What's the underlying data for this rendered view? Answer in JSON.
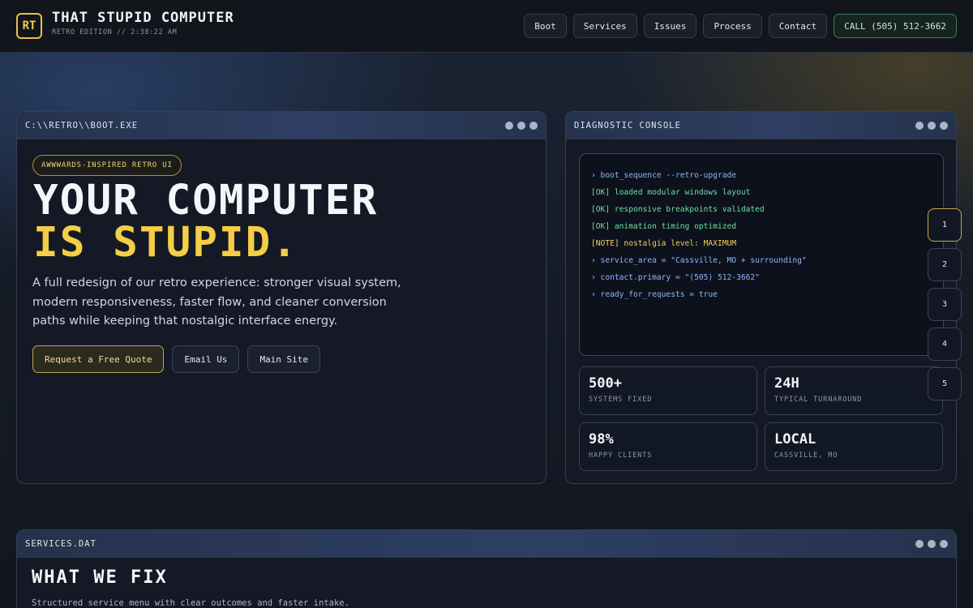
{
  "header": {
    "logo": "RT",
    "title": "THAT STUPID COMPUTER",
    "subtitle": "RETRO EDITION // 2:38:22 AM",
    "nav": [
      {
        "label": "Boot"
      },
      {
        "label": "Services"
      },
      {
        "label": "Issues"
      },
      {
        "label": "Process"
      },
      {
        "label": "Contact"
      }
    ],
    "call_label": "CALL (505) 512-3662"
  },
  "hero": {
    "window_title": "C:\\\\RETRO\\\\BOOT.EXE",
    "tag": "AWWWARDS-INSPIRED RETRO UI",
    "headline_line1": "YOUR COMPUTER",
    "headline_line2": "IS STUPID.",
    "description": "A full redesign of our retro experience: stronger visual system, modern responsiveness, faster flow, and cleaner conversion paths while keeping that nostalgic interface energy.",
    "buttons": {
      "quote": "Request a Free Quote",
      "email": "Email Us",
      "main_site": "Main Site"
    }
  },
  "diagnostic": {
    "window_title": "DIAGNOSTIC CONSOLE",
    "lines": [
      {
        "text": "› boot_sequence --retro-upgrade",
        "color": "#8fb7ff"
      },
      {
        "text": "[OK] loaded modular windows layout",
        "color": "#6fe0a0"
      },
      {
        "text": "[OK] responsive breakpoints validated",
        "color": "#6fe0a0"
      },
      {
        "text": "[OK] animation timing optimized",
        "color": "#6fe0a0"
      },
      {
        "text": "[NOTE] nostalgia level: MAXIMUM",
        "color": "#f4cf5c"
      },
      {
        "text": "› service_area = \"Cassville, MO + surrounding\"",
        "color": "#8fb7ff"
      },
      {
        "text": "› contact.primary = \"(505) 512-3662\"",
        "color": "#8fb7ff"
      },
      {
        "text": "› ready_for_requests = true",
        "color": "#8fb7ff"
      }
    ],
    "stats": [
      {
        "value": "500+",
        "label": "SYSTEMS FIXED"
      },
      {
        "value": "24H",
        "label": "TYPICAL TURNAROUND"
      },
      {
        "value": "98%",
        "label": "HAPPY CLIENTS"
      },
      {
        "value": "LOCAL",
        "label": "CASSVILLE, MO"
      }
    ]
  },
  "steps": [
    "1",
    "2",
    "3",
    "4",
    "5"
  ],
  "active_step": "1",
  "services": {
    "window_title": "SERVICES.DAT",
    "title": "WHAT WE FIX",
    "subtitle": "Structured service menu with clear outcomes and faster intake."
  },
  "colors": {
    "accent_yellow": "#f4cf45",
    "ok_green": "#6fe0a0",
    "prompt_blue": "#8fb7ff"
  }
}
